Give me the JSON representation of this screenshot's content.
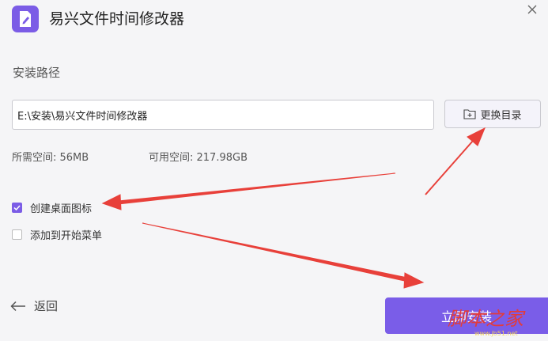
{
  "window": {
    "title": "易兴文件时间修改器",
    "icon": "document-edit-icon",
    "accent_color": "#7b5ce6"
  },
  "install": {
    "section_label": "安装路径",
    "path_value": "E:\\安装\\易兴文件时间修改器",
    "browse_label": "更换目录",
    "required_space": "所需空间: 56MB",
    "available_space": "可用空间: 217.98GB"
  },
  "options": [
    {
      "label": "创建桌面图标",
      "checked": true
    },
    {
      "label": "添加到开始菜单",
      "checked": false
    }
  ],
  "footer": {
    "back_label": "返回",
    "install_label": "立即安装"
  },
  "annotations": {
    "arrow_color": "#e8403a"
  }
}
